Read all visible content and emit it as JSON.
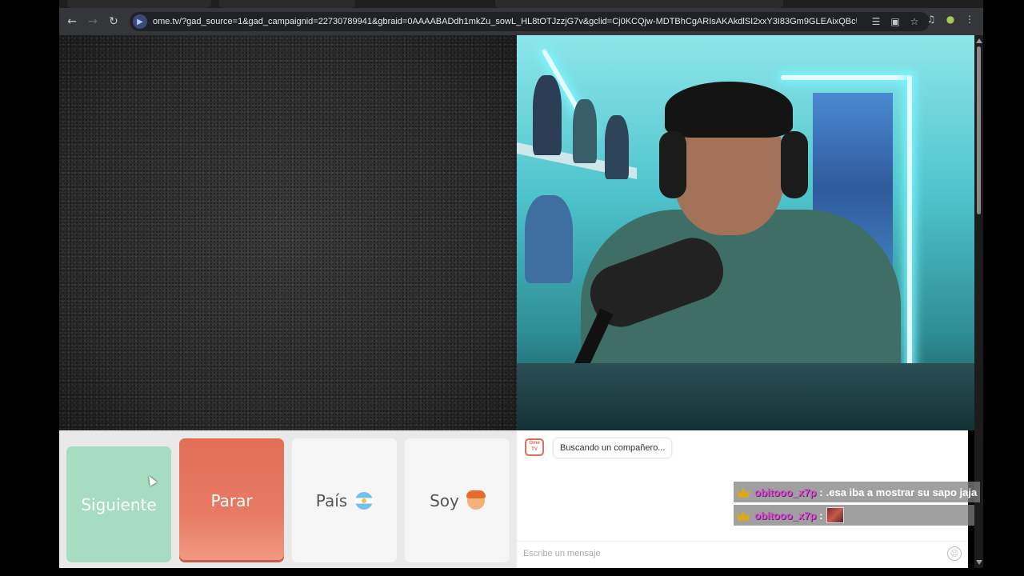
{
  "browser": {
    "url": "ome.tv/?gad_source=1&gad_campaignid=22730789941&gbraid=0AAAABADdh1mkZu_sowL_HL8tOTJzzjG7v&gclid=Cj0KCQjw-MDTBhCgARIsAKAkdlSI2xxY3I83Gm9GLEAixQBcUIjMWI1Q4tpiRz_...",
    "icons": [
      "back-icon",
      "forward-icon",
      "reload-icon",
      "translate-icon",
      "install-icon",
      "bookmark-star-icon",
      "media-icon",
      "extension-icon",
      "menu-icon"
    ]
  },
  "controls": {
    "next_label": "Siguiente",
    "stop_label": "Parar",
    "country_label": "País",
    "country_flag": "argentina-flag-icon",
    "gender_label": "Soy",
    "gender_icon": "person-emoji-icon"
  },
  "chat": {
    "logo_text": "Ome TV",
    "status_message": "Buscando un compañero...",
    "input_placeholder": "Escribe un mensaje"
  },
  "overlay": {
    "messages": [
      {
        "user": "obitooo_x7p",
        "separator": ":",
        "text": ".esa iba a mostrar su sapo jaja"
      },
      {
        "user": "obitooo_x7p",
        "separator": ":",
        "text": "",
        "sticker": "sticker-image"
      }
    ]
  },
  "colors": {
    "next_button": "#a6dcc0",
    "stop_button": "#e26e56",
    "username": "#d64fd0"
  }
}
